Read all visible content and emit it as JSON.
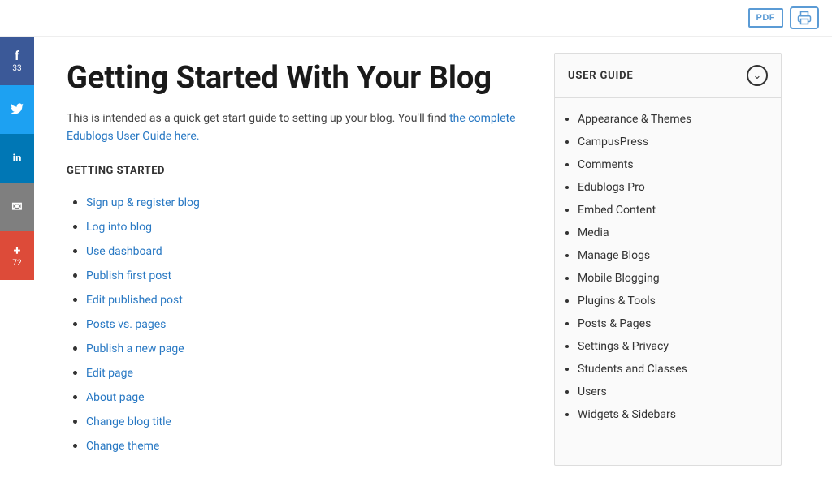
{
  "topbar": {
    "pdf_label": "PDF",
    "print_icon_title": "Print"
  },
  "social": [
    {
      "id": "facebook",
      "letter": "f",
      "count": "33",
      "class": "fb"
    },
    {
      "id": "twitter",
      "letter": "t",
      "count": null,
      "class": "tw"
    },
    {
      "id": "linkedin",
      "letter": "in",
      "count": null,
      "class": "li"
    },
    {
      "id": "email",
      "letter": "✉",
      "count": null,
      "class": "em"
    },
    {
      "id": "plus",
      "letter": "+",
      "count": "72",
      "class": "pl"
    }
  ],
  "page": {
    "title": "Getting Started With Your Blog",
    "intro": "This is intended as a quick get start guide to setting up your blog. You'll find ",
    "link_text": "the complete Edublogs User Guide here.",
    "link_url": "#",
    "section_heading": "GETTING STARTED"
  },
  "getting_started_links": [
    {
      "label": "Sign up & register blog",
      "href": "#"
    },
    {
      "label": "Log into blog",
      "href": "#"
    },
    {
      "label": "Use dashboard",
      "href": "#"
    },
    {
      "label": "Publish first post",
      "href": "#"
    },
    {
      "label": "Edit published post",
      "href": "#"
    },
    {
      "label": "Posts vs. pages",
      "href": "#"
    },
    {
      "label": "Publish a new page",
      "href": "#"
    },
    {
      "label": "Edit page",
      "href": "#"
    },
    {
      "label": "About page",
      "href": "#"
    },
    {
      "label": "Change blog title",
      "href": "#"
    },
    {
      "label": "Change theme",
      "href": "#"
    }
  ],
  "user_guide": {
    "title": "USER GUIDE",
    "items": [
      {
        "label": "Appearance & Themes",
        "href": "#"
      },
      {
        "label": "CampusPress",
        "href": "#"
      },
      {
        "label": "Comments",
        "href": "#"
      },
      {
        "label": "Edublogs Pro",
        "href": "#"
      },
      {
        "label": "Embed Content",
        "href": "#"
      },
      {
        "label": "Media",
        "href": "#"
      },
      {
        "label": "Manage Blogs",
        "href": "#"
      },
      {
        "label": "Mobile Blogging",
        "href": "#"
      },
      {
        "label": "Plugins & Tools",
        "href": "#"
      },
      {
        "label": "Posts & Pages",
        "href": "#"
      },
      {
        "label": "Settings & Privacy",
        "href": "#"
      },
      {
        "label": "Students and Classes",
        "href": "#"
      },
      {
        "label": "Users",
        "href": "#"
      },
      {
        "label": "Widgets & Sidebars",
        "href": "#"
      }
    ]
  }
}
